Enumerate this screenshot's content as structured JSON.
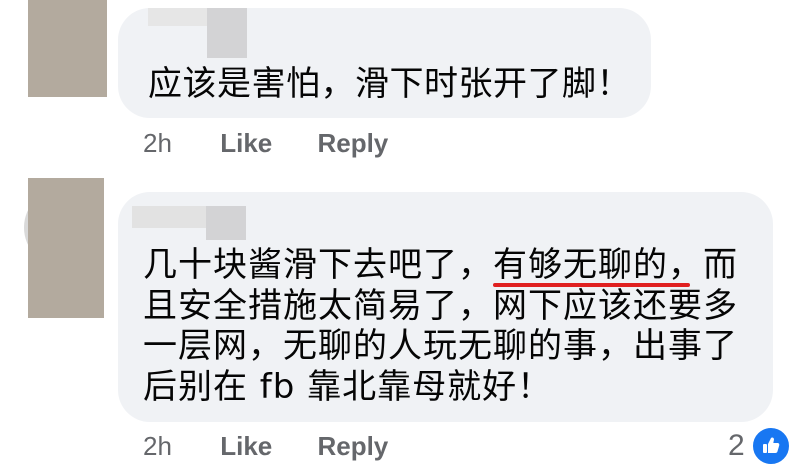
{
  "comment1": {
    "text": "应该是害怕，滑下时张开了脚！",
    "actions": {
      "time": "2h",
      "like": "Like",
      "reply": "Reply"
    }
  },
  "comment2": {
    "lines": [
      "几十块酱滑下去吧了，有够无聊的，而",
      "且安全措施太简易了，网下应该还要多",
      "一层网，无聊的人玩无聊的事，出事了",
      "后别在 fb 靠北靠母就好！"
    ],
    "actions": {
      "time": "2h",
      "like": "Like",
      "reply": "Reply"
    },
    "reactions": {
      "count": "2",
      "icon": "thumbs-up-icon",
      "color": "#1877f2"
    }
  },
  "colors": {
    "bubble": "#f0f2f5",
    "meta_text": "#65676b",
    "highlight_underline": "#e02020",
    "avatar_placeholder": "#b3aa9e"
  }
}
